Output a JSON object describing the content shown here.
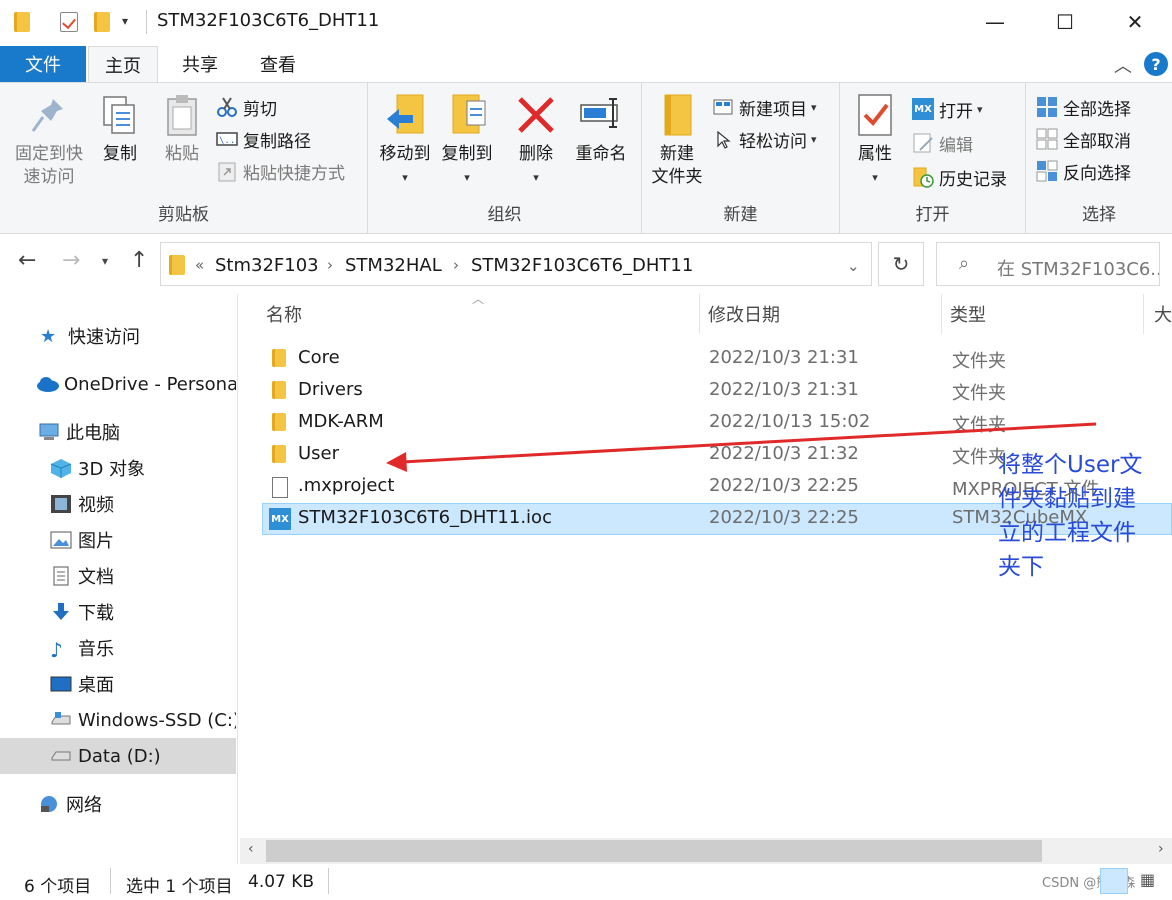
{
  "window": {
    "title": "STM32F103C6T6_DHT11",
    "minimize": "—",
    "maximize": "☐",
    "close": "✕"
  },
  "ribbon_tabs": [
    "文件",
    "主页",
    "共享",
    "查看"
  ],
  "ribbon": {
    "clipboard": {
      "label": "剪贴板",
      "pin": [
        "固定到快",
        "速访问"
      ],
      "copy": "复制",
      "paste": "粘贴",
      "cut": "剪切",
      "copy_path": "复制路径",
      "paste_shortcut": "粘贴快捷方式"
    },
    "organize": {
      "label": "组织",
      "move_to": "移动到",
      "copy_to": "复制到",
      "delete": "删除",
      "rename": "重命名"
    },
    "new": {
      "label": "新建",
      "new_folder": [
        "新建",
        "文件夹"
      ],
      "new_item": "新建项目",
      "easy_access": "轻松访问"
    },
    "open": {
      "label": "打开",
      "properties": "属性",
      "open": "打开",
      "edit": "编辑",
      "history": "历史记录"
    },
    "select": {
      "label": "选择",
      "select_all": "全部选择",
      "select_none": "全部取消",
      "invert": "反向选择"
    }
  },
  "address": {
    "prefix": "«",
    "crumbs": [
      "Stm32F103",
      "STM32HAL",
      "STM32F103C6T6_DHT11"
    ],
    "search_placeholder": "在 STM32F103C6..."
  },
  "nav": [
    {
      "label": "快速访问",
      "icon": "star-icon"
    },
    {
      "label": "OneDrive - Personal",
      "icon": "cloud-icon"
    },
    {
      "label": "此电脑",
      "icon": "computer-icon"
    },
    {
      "label": "3D 对象",
      "icon": "cube-icon"
    },
    {
      "label": "视频",
      "icon": "film-icon"
    },
    {
      "label": "图片",
      "icon": "picture-icon"
    },
    {
      "label": "文档",
      "icon": "document-icon"
    },
    {
      "label": "下载",
      "icon": "download-icon"
    },
    {
      "label": "音乐",
      "icon": "music-icon"
    },
    {
      "label": "桌面",
      "icon": "desktop-icon"
    },
    {
      "label": "Windows-SSD (C:)",
      "icon": "drive-icon"
    },
    {
      "label": "Data (D:)",
      "icon": "drive-icon"
    },
    {
      "label": "网络",
      "icon": "network-icon"
    }
  ],
  "columns": [
    "名称",
    "修改日期",
    "类型",
    "大"
  ],
  "files": [
    {
      "name": "Core",
      "date": "2022/10/3 21:31",
      "type": "文件夹",
      "icon": "folder-icon"
    },
    {
      "name": "Drivers",
      "date": "2022/10/3 21:31",
      "type": "文件夹",
      "icon": "folder-icon"
    },
    {
      "name": "MDK-ARM",
      "date": "2022/10/13 15:02",
      "type": "文件夹",
      "icon": "folder-icon"
    },
    {
      "name": "User",
      "date": "2022/10/3 21:32",
      "type": "文件夹",
      "icon": "folder-icon"
    },
    {
      "name": ".mxproject",
      "date": "2022/10/3 22:25",
      "type": "MXPROJECT 文件",
      "icon": "file-icon"
    },
    {
      "name": "STM32F103C6T6_DHT11.ioc",
      "date": "2022/10/3 22:25",
      "type": "STM32CubeMX",
      "icon": "mx-icon"
    }
  ],
  "annotation": "将整个User文件夹黏贴到建立的工程文件夹下",
  "annotation_color": "#2a4bd7",
  "arrow_color": "#e02a2a",
  "status": {
    "count": "6 个项目",
    "selected": "选中 1 个项目",
    "size": "4.07 KB"
  },
  "watermark": "CSDN @熊先森"
}
